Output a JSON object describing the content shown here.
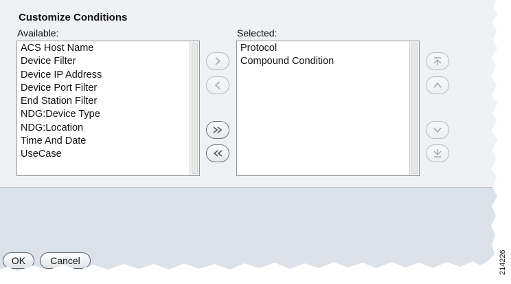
{
  "dialog": {
    "title": "Customize Conditions",
    "available_label": "Available:",
    "selected_label": "Selected:",
    "available_items": [
      "ACS Host Name",
      "Device Filter",
      "Device IP Address",
      "Device Port Filter",
      "End Station Filter",
      "NDG:Device Type",
      "NDG:Location",
      "Time And Date",
      "UseCase"
    ],
    "selected_items": [
      "Protocol",
      "Compound Condition"
    ],
    "move_buttons": [
      "arrow-right-icon",
      "arrow-left-icon",
      "double-arrow-right-icon",
      "double-arrow-left-icon"
    ],
    "order_buttons": [
      "move-top-icon",
      "move-up-icon",
      "move-down-icon",
      "move-bottom-icon"
    ]
  },
  "footer": {
    "ok_label": "OK",
    "cancel_label": "Cancel"
  },
  "figure_number": "214226",
  "colors": {
    "panel": "#eff1f4",
    "background": "#dce2e9"
  }
}
